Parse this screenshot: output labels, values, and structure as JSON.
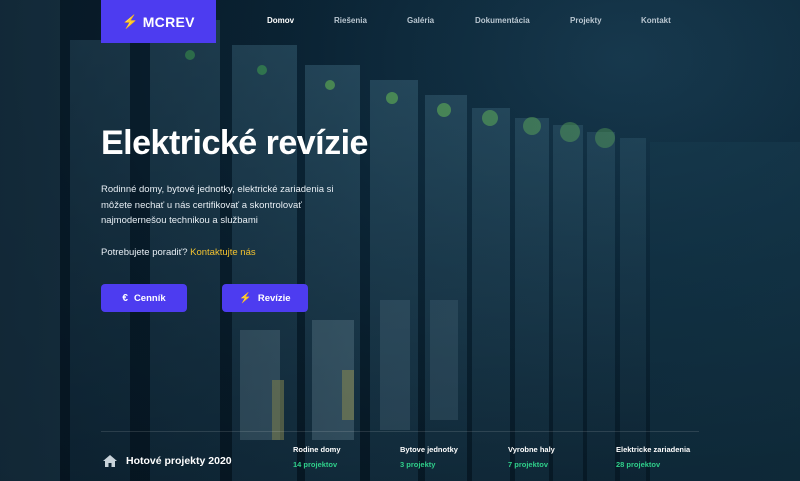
{
  "brand": {
    "icon": "lightning-bolt-icon",
    "name": "MCREV"
  },
  "nav": {
    "items": [
      {
        "label": "Domov",
        "active": true
      },
      {
        "label": "Riešenia",
        "active": false
      },
      {
        "label": "Galéria",
        "active": false
      },
      {
        "label": "Dokumentácia",
        "active": false
      },
      {
        "label": "Projekty",
        "active": false
      },
      {
        "label": "Kontakt",
        "active": false
      }
    ]
  },
  "hero": {
    "title": "Elektrické revízie",
    "description": "Rodinné domy, bytové jednotky, elektrické zariadenia si môžete nechať u nás certifikovať a skontrolovať najmodernešou technikou a službami",
    "help_text": "Potrebujete poradiť?",
    "help_link": "Kontaktujte nás"
  },
  "buttons": {
    "pricing": {
      "icon": "euro-icon",
      "label": "Cenník"
    },
    "revisions": {
      "icon": "lightning-bolt-icon",
      "label": "Revízie"
    }
  },
  "projects": {
    "icon": "home-icon",
    "title": "Hotové projekty 2020",
    "stats": [
      {
        "label": "Rodine domy",
        "count": "14 projektov"
      },
      {
        "label": "Bytove jednotky",
        "count": "3 projekty"
      },
      {
        "label": "Vyrobne haly",
        "count": "7 projektov"
      },
      {
        "label": "Elektricke zariadenia",
        "count": "28 projektov"
      }
    ]
  },
  "colors": {
    "accent": "#4d3cf0",
    "link": "#f2c230",
    "count": "#2fcf8a"
  }
}
